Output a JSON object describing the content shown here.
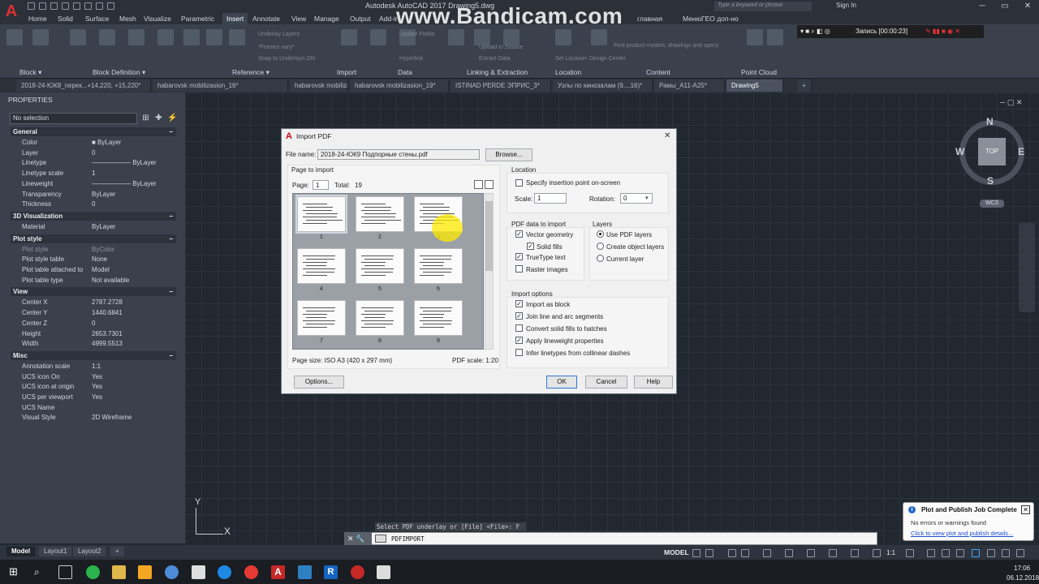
{
  "title_bar": {
    "app_title": "Autodesk AutoCAD 2017   Drawing5.dwg",
    "search_placeholder": "Type a keyword or phrase",
    "sign_in": "Sign In",
    "watermark": "www.Bandicam.com"
  },
  "menu_tabs": [
    "Home",
    "Solid",
    "Surface",
    "Mesh",
    "Visualize",
    "Parametric",
    "Insert",
    "Annotate",
    "View",
    "Manage",
    "Output",
    "Add-in"
  ],
  "menu_extra": [
    "главная",
    "МенюГЕО доп-но"
  ],
  "active_menu": "Insert",
  "ribbon": {
    "panels": [
      "Block ▾",
      "Block Definition ▾",
      "Reference ▾",
      "Import",
      "Data",
      "Linking & Extraction",
      "Location",
      "Content",
      "Point Cloud"
    ],
    "faded_labels": [
      "Underlay Layers",
      "*Frames vary*",
      "Snap to Underlays ON",
      "Hyperlink",
      "Update Fields",
      "Upload to Source",
      "Extract Data",
      "Find product models, drawings and specs",
      "Set Location",
      "Design Center"
    ]
  },
  "recorder": {
    "label": "Запись [00:00:23]"
  },
  "file_tabs": [
    {
      "label": "2018-24-ЮК8_перек...+14,220, +15,220*",
      "active": false
    },
    {
      "label": "habarovsk mobilizasion_16*",
      "active": false
    },
    {
      "label": "habarovsk mobilizasion_7*",
      "active": false
    },
    {
      "label": "habarovsk mobilizasion_19*",
      "active": false
    },
    {
      "label": "ISTINAD PERDE ЭПРИС_3*",
      "active": false
    },
    {
      "label": "Узлы по кинозалам (9....16)*",
      "active": false
    },
    {
      "label": "Рамы_А11-А25*",
      "active": false
    },
    {
      "label": "Drawing5",
      "active": true
    }
  ],
  "properties": {
    "header": "PROPERTIES",
    "selection": "No selection",
    "sections": [
      {
        "title": "General",
        "rows": [
          {
            "k": "Color",
            "v": "■ ByLayer"
          },
          {
            "k": "Layer",
            "v": "0"
          },
          {
            "k": "Linetype",
            "v": "——————  ByLayer"
          },
          {
            "k": "Linetype scale",
            "v": "1"
          },
          {
            "k": "Lineweight",
            "v": "——————  ByLayer"
          },
          {
            "k": "Transparency",
            "v": "ByLayer"
          },
          {
            "k": "Thickness",
            "v": "0"
          }
        ]
      },
      {
        "title": "3D Visualization",
        "rows": [
          {
            "k": "Material",
            "v": "ByLayer"
          }
        ]
      },
      {
        "title": "Plot style",
        "rows": [
          {
            "k": "Plot style",
            "v": "ByColor",
            "dim": true
          },
          {
            "k": "Plot style table",
            "v": "None"
          },
          {
            "k": "Plot table attached to",
            "v": "Model"
          },
          {
            "k": "Plot table type",
            "v": "Not available"
          }
        ]
      },
      {
        "title": "View",
        "rows": [
          {
            "k": "Center X",
            "v": "2787.2728"
          },
          {
            "k": "Center Y",
            "v": "1440.6841"
          },
          {
            "k": "Center Z",
            "v": "0"
          },
          {
            "k": "Height",
            "v": "2653.7301"
          },
          {
            "k": "Width",
            "v": "4999.5513"
          }
        ]
      },
      {
        "title": "Misc",
        "rows": [
          {
            "k": "Annotation scale",
            "v": "1:1"
          },
          {
            "k": "UCS icon On",
            "v": "Yes"
          },
          {
            "k": "UCS icon at origin",
            "v": "Yes"
          },
          {
            "k": "UCS per viewport",
            "v": "Yes"
          },
          {
            "k": "UCS Name",
            "v": ""
          },
          {
            "k": "Visual Style",
            "v": "2D Wireframe"
          }
        ]
      }
    ]
  },
  "viewcube": {
    "top": "TOP",
    "n": "N",
    "s": "S",
    "e": "E",
    "w": "W",
    "wcs": "WCS"
  },
  "dialog": {
    "title": "Import PDF",
    "file_name_label": "File name:",
    "file_name": "2018-24-ЮК9 Подпорные стены.pdf",
    "browse": "Browse...",
    "page_to_import": "Page to import",
    "page_label": "Page:",
    "page_value": "1",
    "total_label": "Total:",
    "total_value": "19",
    "thumbnails": [
      "1",
      "2",
      "3",
      "4",
      "5",
      "6",
      "7",
      "8",
      "9"
    ],
    "page_size": "Page size: ISO A3 (420 x 297 mm)",
    "pdf_scale": "PDF scale: 1:20",
    "location_title": "Location",
    "specify_insertion": "Specify insertion point on-screen",
    "scale_label": "Scale:",
    "scale_value": "1",
    "rotation_label": "Rotation:",
    "rotation_value": "0",
    "pdf_data_title": "PDF data to import",
    "vector_geometry": "Vector geometry",
    "solid_fills": "Solid fills",
    "truetype_text": "TrueType text",
    "raster_images": "Raster images",
    "layers_title": "Layers",
    "use_pdf_layers": "Use PDF layers",
    "create_object_layers": "Create object layers",
    "current_layer": "Current layer",
    "import_options_title": "Import options",
    "import_as_block": "Import as block",
    "join_line_arc": "Join line and arc segments",
    "convert_solid_fills": "Convert solid fills to hatches",
    "apply_lineweight": "Apply lineweight properties",
    "infer_linetypes": "Infer linetypes from collinear dashes",
    "options_btn": "Options...",
    "ok_btn": "OK",
    "cancel_btn": "Cancel",
    "help_btn": "Help"
  },
  "command": {
    "hint": "Select PDF underlay or [File] <File>: F",
    "input": "PDFIMPORT"
  },
  "layout_tabs": [
    "Model",
    "Layout1",
    "Layout2",
    "+"
  ],
  "status": {
    "model": "MODEL",
    "scale": "1:1"
  },
  "notification": {
    "title": "Plot and Publish Job Complete",
    "body": "No errors or warnings found",
    "link": "Click to view plot and publish details..."
  },
  "clock": {
    "time": "17:06",
    "date": "06.12.2018"
  }
}
